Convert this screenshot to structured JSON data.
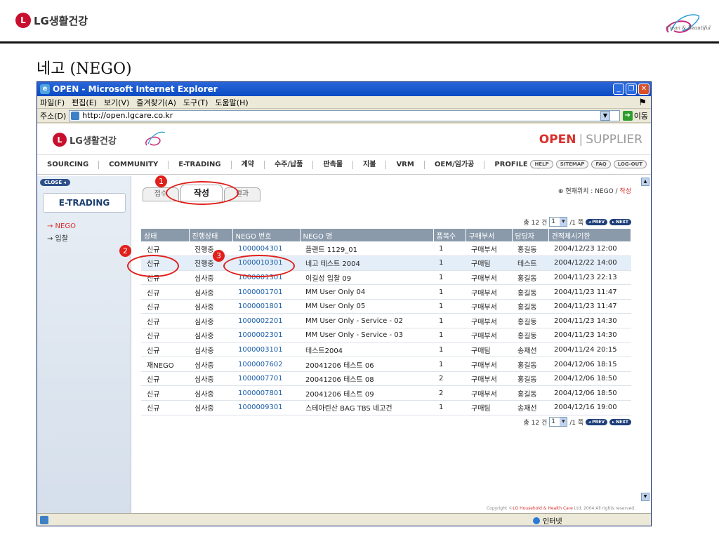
{
  "slide": {
    "brand": "LG생활건강",
    "title": "네고 (NEGO)",
    "clean_logo_text": "Clean & Beautiful"
  },
  "browser": {
    "title": "OPEN - Microsoft Internet Explorer",
    "menu": [
      "파일(F)",
      "편집(E)",
      "보기(V)",
      "즐겨찾기(A)",
      "도구(T)",
      "도움말(H)"
    ],
    "address_label": "주소(D)",
    "address": "http://open.lgcare.co.kr",
    "go_label": "이동",
    "status_zone": "인터넷"
  },
  "site": {
    "brand": "LG생활건강",
    "open": "OPEN",
    "supplier": "SUPPLIER",
    "nav": [
      "SOURCING",
      "COMMUNITY",
      "E-TRADING",
      "계약",
      "수주/납품",
      "판촉물",
      "지불",
      "VRM",
      "OEM/임가공",
      "PROFILE"
    ],
    "util": [
      "HELP",
      "SITEMAP",
      "FAQ",
      "LOG-OUT"
    ],
    "copyright_prefix": "Copyright ",
    "copyright_brand": "LG Household & Health Care",
    "copyright_suffix": " Ltd. 2004 All rights reserved."
  },
  "sidebar": {
    "close": "CLOSE",
    "section": "E-TRADING",
    "items": [
      "→ NEGO",
      "→ 입찰"
    ]
  },
  "main": {
    "tabs": [
      "접수",
      "작성",
      "결과"
    ],
    "location_prefix": "현재위치 : NEGO / ",
    "location_current": "작성",
    "pager": {
      "total": "총 12 건",
      "page": "1",
      "suffix": "/1 쪽",
      "prev": "PREV",
      "next": "NEXT"
    },
    "columns": [
      "상태",
      "진행상태",
      "NEGO 번호",
      "NEGO 명",
      "품목수",
      "구매부서",
      "담당자",
      "견적제시기한"
    ],
    "rows": [
      [
        "신규",
        "진행중",
        "1000004301",
        "플랜트 1129_01",
        "1",
        "구매부서",
        "홍길동",
        "2004/12/23 12:00"
      ],
      [
        "신규",
        "진행중",
        "1000010301",
        "네고 테스트 2004",
        "1",
        "구매팀",
        "테스트",
        "2004/12/22 14:00"
      ],
      [
        "신규",
        "심사중",
        "1000001301",
        "이길성 입찰 09",
        "1",
        "구매부서",
        "홍길동",
        "2004/11/23 22:13"
      ],
      [
        "신규",
        "심사중",
        "1000001701",
        "MM User Only 04",
        "1",
        "구매부서",
        "홍길동",
        "2004/11/23 11:47"
      ],
      [
        "신규",
        "심사중",
        "1000001801",
        "MM User Only 05",
        "1",
        "구매부서",
        "홍길동",
        "2004/11/23 11:47"
      ],
      [
        "신규",
        "심사중",
        "1000002201",
        "MM User Only - Service - 02",
        "1",
        "구매부서",
        "홍길동",
        "2004/11/23 14:30"
      ],
      [
        "신규",
        "심사중",
        "1000002301",
        "MM User Only - Service - 03",
        "1",
        "구매부서",
        "홍길동",
        "2004/11/23 14:30"
      ],
      [
        "신규",
        "심사중",
        "1000003101",
        "테스트2004",
        "1",
        "구매팀",
        "송재선",
        "2004/11/24 20:15"
      ],
      [
        "재NEGO",
        "심사중",
        "1000007602",
        "20041206 테스트 06",
        "1",
        "구매부서",
        "홍길동",
        "2004/12/06 18:15"
      ],
      [
        "신규",
        "심사중",
        "1000007701",
        "20041206 테스트 08",
        "2",
        "구매부서",
        "홍길동",
        "2004/12/06 18:50"
      ],
      [
        "신규",
        "심사중",
        "1000007801",
        "20041206 테스트 09",
        "2",
        "구매부서",
        "홍길동",
        "2004/12/06 18:50"
      ],
      [
        "신규",
        "심사중",
        "1000009301",
        "스테아린산 BAG TBS 네고건",
        "1",
        "구매팀",
        "송재선",
        "2004/12/16 19:00"
      ]
    ]
  },
  "annotations": [
    "1",
    "2",
    "3"
  ],
  "colors": {
    "accent": "#d9302b",
    "annotation": "#e0201a",
    "header": "#8a9aab"
  }
}
